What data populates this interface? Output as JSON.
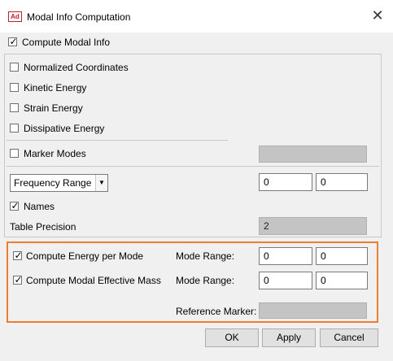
{
  "window": {
    "title": "Modal Info Computation",
    "app_badge": "Ad"
  },
  "options": {
    "compute_modal_info": {
      "label": "Compute Modal Info",
      "checked": true
    },
    "normalized_coordinates": {
      "label": "Normalized Coordinates",
      "checked": false
    },
    "kinetic_energy": {
      "label": "Kinetic Energy",
      "checked": false
    },
    "strain_energy": {
      "label": "Strain Energy",
      "checked": false
    },
    "dissipative_energy": {
      "label": "Dissipative Energy",
      "checked": false
    },
    "marker_modes": {
      "label": "Marker Modes",
      "checked": false,
      "value": ""
    }
  },
  "range": {
    "selected": "Frequency Range",
    "from": "0",
    "to": "0",
    "names": {
      "label": "Names",
      "checked": true
    },
    "table_precision_label": "Table Precision",
    "table_precision_value": "2"
  },
  "energy": {
    "compute_energy_per_mode": {
      "label": "Compute Energy per Mode",
      "checked": true
    },
    "mode_range_label_1": "Mode Range:",
    "energy_from": "0",
    "energy_to": "0",
    "compute_modal_effective_mass": {
      "label": "Compute Modal Effective Mass",
      "checked": true
    },
    "mode_range_label_2": "Mode Range:",
    "mass_from": "0",
    "mass_to": "0",
    "reference_marker_label": "Reference Marker:",
    "reference_marker_value": ""
  },
  "buttons": {
    "ok": "OK",
    "apply": "Apply",
    "cancel": "Cancel"
  },
  "colors": {
    "highlight": "#ed7d31",
    "app_icon": "#c0202a",
    "dialog_bg": "#f0f0f0"
  }
}
